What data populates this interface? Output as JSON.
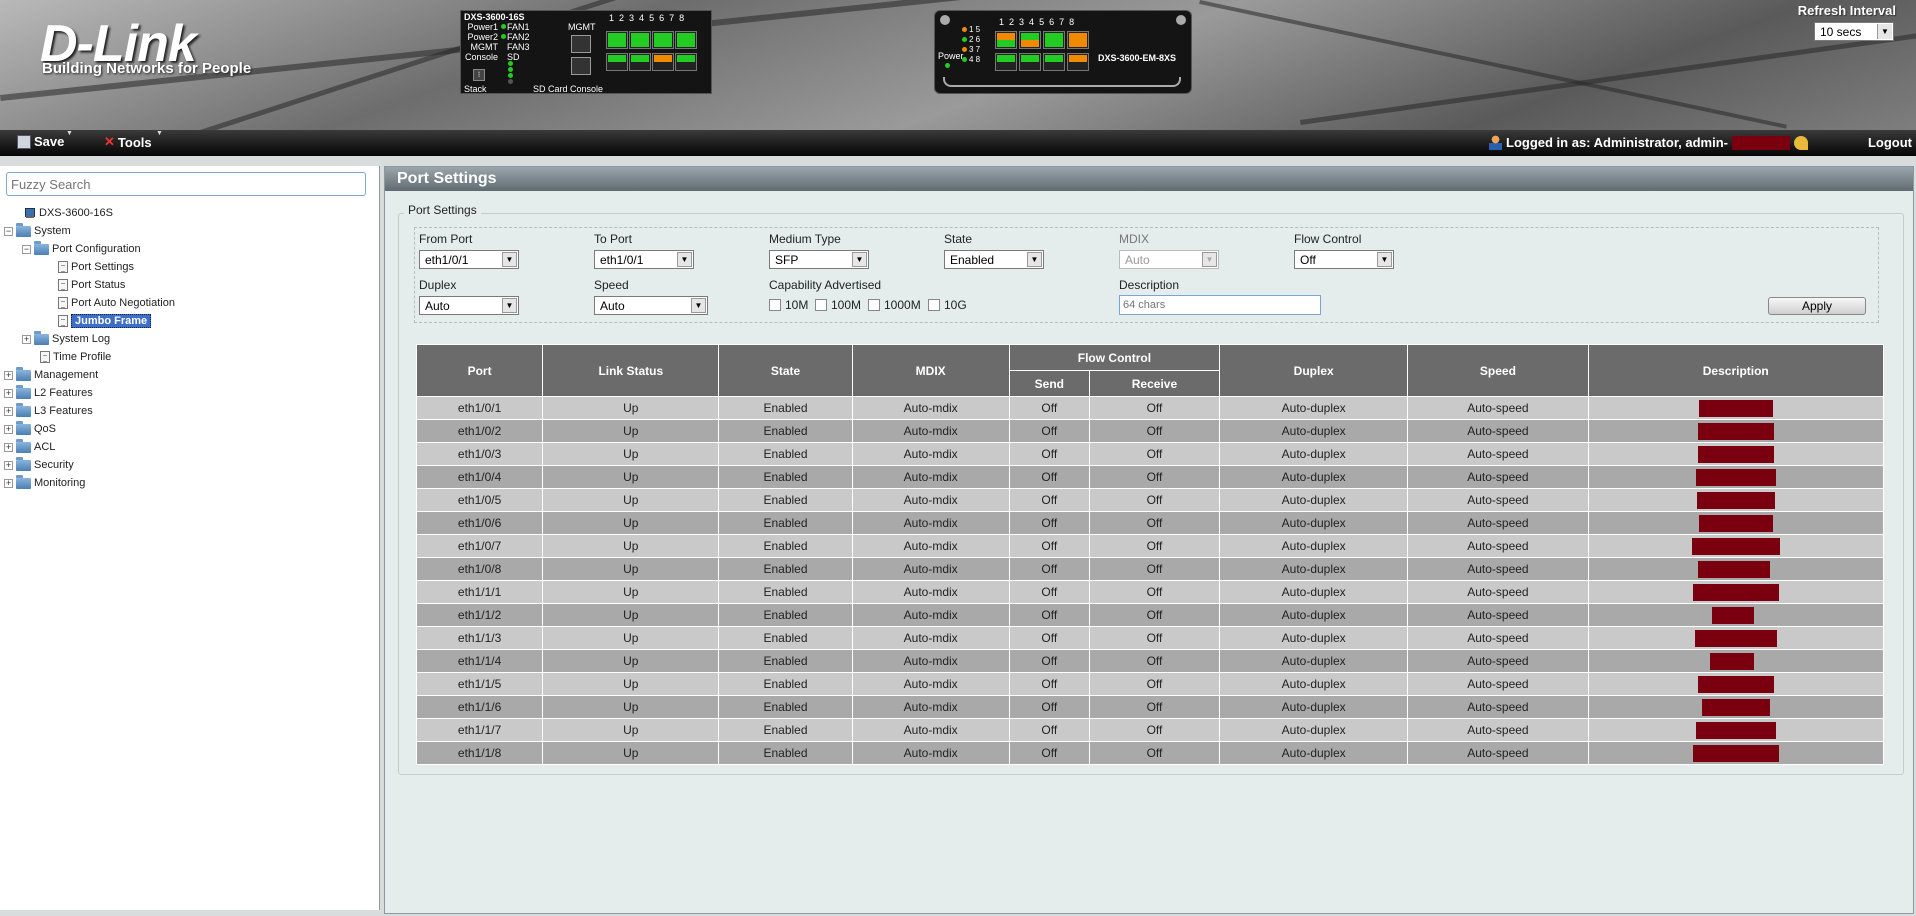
{
  "header": {
    "brand": "D-Link",
    "tagline": "Building Networks for People",
    "refresh_label": "Refresh Interval",
    "refresh_value": "10 secs",
    "device_main": {
      "model": "DXS-3600-16S",
      "labels_left": [
        "Power1",
        "Power2",
        "MGMT",
        "Console"
      ],
      "labels_right": [
        "FAN1",
        "FAN2",
        "FAN3",
        "SD"
      ],
      "mgmt_label": "MGMT",
      "stack_label": "Stack",
      "sd_console_label": "SD Card Console",
      "port_numbers": [
        "1",
        "2",
        "3",
        "4",
        "5",
        "6",
        "7",
        "8"
      ]
    },
    "device_expansion": {
      "model": "DXS-3600-EM-8XS",
      "power_label": "Power",
      "led_numbers": [
        "1 5",
        "2 6",
        "3 7",
        "4 8"
      ],
      "port_numbers": [
        "1",
        "2",
        "3",
        "4",
        "5",
        "6",
        "7",
        "8"
      ]
    }
  },
  "menubar": {
    "save_label": "Save",
    "tools_label": "Tools",
    "login_text": "Logged in as: Administrator, admin-",
    "logout_label": "Logout"
  },
  "sidebar": {
    "search_placeholder": "Fuzzy Search",
    "root": "DXS-3600-16S",
    "system": "System",
    "port_configuration": "Port Configuration",
    "port_settings": "Port Settings",
    "port_status": "Port Status",
    "port_auto_negotiation": "Port Auto Negotiation",
    "jumbo_frame": "Jumbo Frame",
    "system_log": "System Log",
    "time_profile": "Time Profile",
    "management": "Management",
    "l2_features": "L2 Features",
    "l3_features": "L3 Features",
    "qos": "QoS",
    "acl": "ACL",
    "security": "Security",
    "monitoring": "Monitoring"
  },
  "main": {
    "title": "Port Settings",
    "fieldset_legend": "Port Settings",
    "form": {
      "from_port_label": "From Port",
      "from_port_value": "eth1/0/1",
      "to_port_label": "To Port",
      "to_port_value": "eth1/0/1",
      "medium_type_label": "Medium Type",
      "medium_type_value": "SFP",
      "state_label": "State",
      "state_value": "Enabled",
      "mdix_label": "MDIX",
      "mdix_value": "Auto",
      "flow_control_label": "Flow Control",
      "flow_control_value": "Off",
      "duplex_label": "Duplex",
      "duplex_value": "Auto",
      "speed_label": "Speed",
      "speed_value": "Auto",
      "capability_label": "Capability Advertised",
      "capabilities": [
        "10M",
        "100M",
        "1000M",
        "10G"
      ],
      "description_label": "Description",
      "description_placeholder": "64 chars",
      "apply_label": "Apply"
    },
    "table": {
      "headers": {
        "port": "Port",
        "link_status": "Link Status",
        "state": "State",
        "mdix": "MDIX",
        "flow_control": "Flow Control",
        "send": "Send",
        "receive": "Receive",
        "duplex": "Duplex",
        "speed": "Speed",
        "description": "Description"
      },
      "rows": [
        {
          "port": "eth1/0/1",
          "link": "Up",
          "state": "Enabled",
          "mdix": "Auto-mdix",
          "send": "Off",
          "receive": "Off",
          "duplex": "Auto-duplex",
          "speed": "Auto-speed"
        },
        {
          "port": "eth1/0/2",
          "link": "Up",
          "state": "Enabled",
          "mdix": "Auto-mdix",
          "send": "Off",
          "receive": "Off",
          "duplex": "Auto-duplex",
          "speed": "Auto-speed"
        },
        {
          "port": "eth1/0/3",
          "link": "Up",
          "state": "Enabled",
          "mdix": "Auto-mdix",
          "send": "Off",
          "receive": "Off",
          "duplex": "Auto-duplex",
          "speed": "Auto-speed"
        },
        {
          "port": "eth1/0/4",
          "link": "Up",
          "state": "Enabled",
          "mdix": "Auto-mdix",
          "send": "Off",
          "receive": "Off",
          "duplex": "Auto-duplex",
          "speed": "Auto-speed"
        },
        {
          "port": "eth1/0/5",
          "link": "Up",
          "state": "Enabled",
          "mdix": "Auto-mdix",
          "send": "Off",
          "receive": "Off",
          "duplex": "Auto-duplex",
          "speed": "Auto-speed"
        },
        {
          "port": "eth1/0/6",
          "link": "Up",
          "state": "Enabled",
          "mdix": "Auto-mdix",
          "send": "Off",
          "receive": "Off",
          "duplex": "Auto-duplex",
          "speed": "Auto-speed"
        },
        {
          "port": "eth1/0/7",
          "link": "Up",
          "state": "Enabled",
          "mdix": "Auto-mdix",
          "send": "Off",
          "receive": "Off",
          "duplex": "Auto-duplex",
          "speed": "Auto-speed"
        },
        {
          "port": "eth1/0/8",
          "link": "Up",
          "state": "Enabled",
          "mdix": "Auto-mdix",
          "send": "Off",
          "receive": "Off",
          "duplex": "Auto-duplex",
          "speed": "Auto-speed"
        },
        {
          "port": "eth1/1/1",
          "link": "Up",
          "state": "Enabled",
          "mdix": "Auto-mdix",
          "send": "Off",
          "receive": "Off",
          "duplex": "Auto-duplex",
          "speed": "Auto-speed"
        },
        {
          "port": "eth1/1/2",
          "link": "Up",
          "state": "Enabled",
          "mdix": "Auto-mdix",
          "send": "Off",
          "receive": "Off",
          "duplex": "Auto-duplex",
          "speed": "Auto-speed"
        },
        {
          "port": "eth1/1/3",
          "link": "Up",
          "state": "Enabled",
          "mdix": "Auto-mdix",
          "send": "Off",
          "receive": "Off",
          "duplex": "Auto-duplex",
          "speed": "Auto-speed"
        },
        {
          "port": "eth1/1/4",
          "link": "Up",
          "state": "Enabled",
          "mdix": "Auto-mdix",
          "send": "Off",
          "receive": "Off",
          "duplex": "Auto-duplex",
          "speed": "Auto-speed"
        },
        {
          "port": "eth1/1/5",
          "link": "Up",
          "state": "Enabled",
          "mdix": "Auto-mdix",
          "send": "Off",
          "receive": "Off",
          "duplex": "Auto-duplex",
          "speed": "Auto-speed"
        },
        {
          "port": "eth1/1/6",
          "link": "Up",
          "state": "Enabled",
          "mdix": "Auto-mdix",
          "send": "Off",
          "receive": "Off",
          "duplex": "Auto-duplex",
          "speed": "Auto-speed"
        },
        {
          "port": "eth1/1/7",
          "link": "Up",
          "state": "Enabled",
          "mdix": "Auto-mdix",
          "send": "Off",
          "receive": "Off",
          "duplex": "Auto-duplex",
          "speed": "Auto-speed"
        },
        {
          "port": "eth1/1/8",
          "link": "Up",
          "state": "Enabled",
          "mdix": "Auto-mdix",
          "send": "Off",
          "receive": "Off",
          "duplex": "Auto-duplex",
          "speed": "Auto-speed"
        }
      ]
    }
  },
  "colors": {
    "redaction": "#7a0010",
    "selected_node": "#3d6ec9",
    "header_row": "#6b6b6b",
    "row_light": "#c9c9c9",
    "row_dark": "#a9a9a9",
    "port_green": "#22c022",
    "port_orange": "#f08a00"
  }
}
